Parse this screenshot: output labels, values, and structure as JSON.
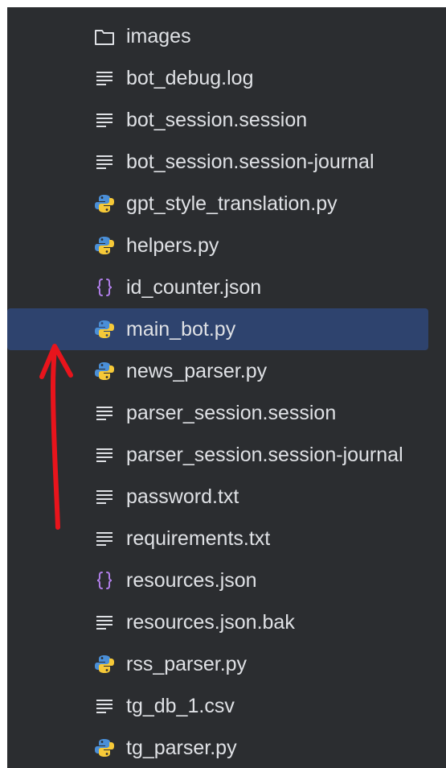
{
  "file_tree": {
    "items": [
      {
        "label": "images",
        "icon": "folder-icon",
        "selected": false
      },
      {
        "label": "bot_debug.log",
        "icon": "text-file-icon",
        "selected": false
      },
      {
        "label": "bot_session.session",
        "icon": "text-file-icon",
        "selected": false
      },
      {
        "label": "bot_session.session-journal",
        "icon": "text-file-icon",
        "selected": false
      },
      {
        "label": "gpt_style_translation.py",
        "icon": "python-file-icon",
        "selected": false
      },
      {
        "label": "helpers.py",
        "icon": "python-file-icon",
        "selected": false
      },
      {
        "label": "id_counter.json",
        "icon": "json-file-icon",
        "selected": false
      },
      {
        "label": "main_bot.py",
        "icon": "python-file-icon",
        "selected": true
      },
      {
        "label": "news_parser.py",
        "icon": "python-file-icon",
        "selected": false
      },
      {
        "label": "parser_session.session",
        "icon": "text-file-icon",
        "selected": false
      },
      {
        "label": "parser_session.session-journal",
        "icon": "text-file-icon",
        "selected": false
      },
      {
        "label": "password.txt",
        "icon": "text-file-icon",
        "selected": false
      },
      {
        "label": "requirements.txt",
        "icon": "text-file-icon",
        "selected": false
      },
      {
        "label": "resources.json",
        "icon": "json-file-icon",
        "selected": false
      },
      {
        "label": "resources.json.bak",
        "icon": "text-file-icon",
        "selected": false
      },
      {
        "label": "rss_parser.py",
        "icon": "python-file-icon",
        "selected": false
      },
      {
        "label": "tg_db_1.csv",
        "icon": "text-file-icon",
        "selected": false
      },
      {
        "label": "tg_parser.py",
        "icon": "python-file-icon",
        "selected": false
      }
    ]
  },
  "colors": {
    "panel_background": "#2b2d30",
    "selection": "#2e436e",
    "text": "#dfe1e5",
    "annotation_arrow": "#e8141c",
    "python_blue": "#4a8fd8",
    "python_yellow": "#f6c938"
  }
}
